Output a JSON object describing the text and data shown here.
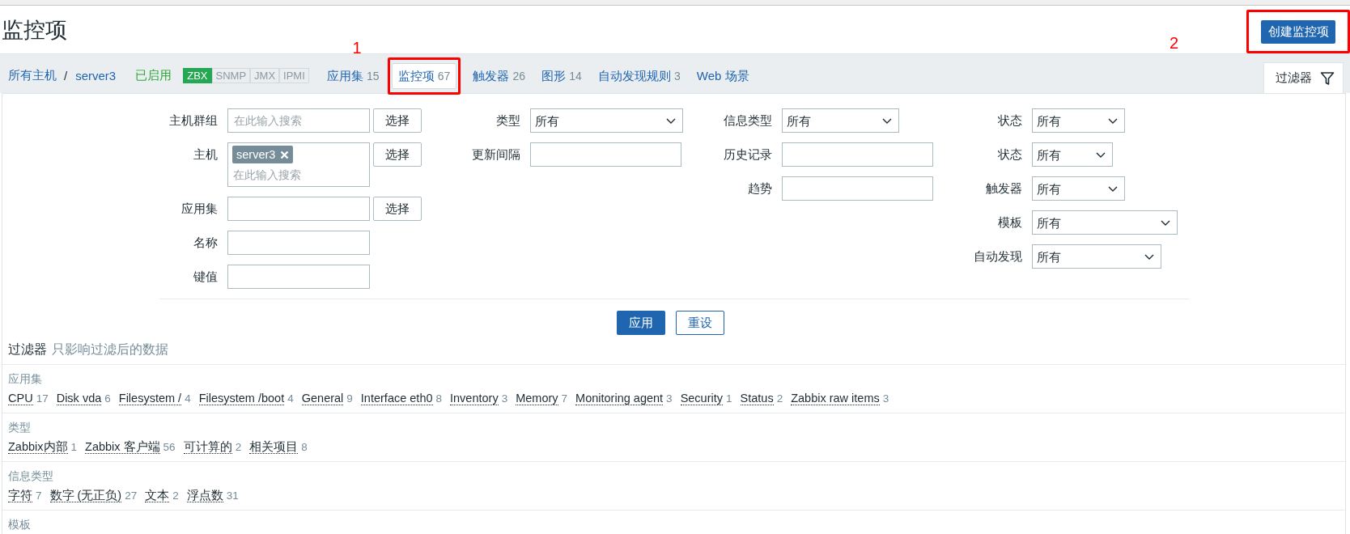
{
  "page_title": "监控项",
  "create_button": {
    "label": "创建监控项",
    "annotation": "2"
  },
  "breadcrumbs": [
    {
      "label": "所有主机"
    },
    {
      "label": "server3"
    }
  ],
  "breadcrumb_separator": "/",
  "status": "已启用",
  "interfaces": [
    {
      "label": "ZBX",
      "on": true
    },
    {
      "label": "SNMP",
      "on": false
    },
    {
      "label": "JMX",
      "on": false
    },
    {
      "label": "IPMI",
      "on": false
    }
  ],
  "nav_tabs": [
    {
      "label": "应用集",
      "count": "15",
      "selected": false
    },
    {
      "label": "监控项",
      "count": "67",
      "selected": true,
      "annotation": "1"
    },
    {
      "label": "触发器",
      "count": "26",
      "selected": false
    },
    {
      "label": "图形",
      "count": "14",
      "selected": false
    },
    {
      "label": "自动发现规则",
      "count": "3",
      "selected": false
    },
    {
      "label": "Web 场景",
      "selected": false
    }
  ],
  "filter_tab": {
    "label": "过滤器",
    "selected": true
  },
  "filter_form": {
    "columns": [
      [
        {
          "label": "主机群组",
          "kind": "multiselect",
          "placeholder": "在此输入搜索",
          "button": "选择"
        },
        {
          "label": "主机",
          "kind": "multiselect",
          "tags": [
            "server3"
          ],
          "placeholder": "在此输入搜索",
          "button": "选择"
        },
        {
          "label": "应用集",
          "kind": "text",
          "button": "选择"
        },
        {
          "label": "名称",
          "kind": "text"
        },
        {
          "label": "键值",
          "kind": "text"
        }
      ],
      [
        {
          "label": "类型",
          "kind": "select",
          "value": "所有"
        },
        {
          "label": "更新间隔",
          "kind": "text"
        }
      ],
      [
        {
          "label": "信息类型",
          "kind": "select",
          "value": "所有"
        },
        {
          "label": "历史记录",
          "kind": "text"
        },
        {
          "label": "趋势",
          "kind": "text"
        }
      ],
      [
        {
          "label": "状态",
          "kind": "select",
          "value": "所有"
        },
        {
          "label": "状态",
          "kind": "select",
          "value": "所有"
        },
        {
          "label": "触发器",
          "kind": "select",
          "value": "所有"
        },
        {
          "label": "模板",
          "kind": "select",
          "value": "所有"
        },
        {
          "label": "自动发现",
          "kind": "select",
          "value": "所有"
        }
      ]
    ],
    "buttons": [
      {
        "label": "应用",
        "kind": "primary"
      },
      {
        "label": "重设",
        "kind": "secondary"
      }
    ]
  },
  "subfilter": {
    "title": "过滤器",
    "note": "只影响过滤后的数据",
    "groups": [
      {
        "title": "应用集",
        "items": [
          {
            "label": "CPU",
            "count": "17"
          },
          {
            "label": "Disk vda",
            "count": "6"
          },
          {
            "label": "Filesystem /",
            "count": "4"
          },
          {
            "label": "Filesystem /boot",
            "count": "4"
          },
          {
            "label": "General",
            "count": "9"
          },
          {
            "label": "Interface eth0",
            "count": "8"
          },
          {
            "label": "Inventory",
            "count": "3"
          },
          {
            "label": "Memory",
            "count": "7"
          },
          {
            "label": "Monitoring agent",
            "count": "3"
          },
          {
            "label": "Security",
            "count": "1"
          },
          {
            "label": "Status",
            "count": "2"
          },
          {
            "label": "Zabbix raw items",
            "count": "3"
          }
        ]
      },
      {
        "title": "类型",
        "items": [
          {
            "label": "Zabbix内部",
            "count": "1"
          },
          {
            "label": "Zabbix 客户端",
            "count": "56"
          },
          {
            "label": "可计算的",
            "count": "2"
          },
          {
            "label": "相关项目",
            "count": "8"
          }
        ]
      },
      {
        "title": "信息类型",
        "items": [
          {
            "label": "字符",
            "count": "7"
          },
          {
            "label": "数字 (无正负)",
            "count": "27"
          },
          {
            "label": "文本",
            "count": "2"
          },
          {
            "label": "浮点数",
            "count": "31"
          }
        ]
      },
      {
        "title": "模板"
      }
    ]
  }
}
